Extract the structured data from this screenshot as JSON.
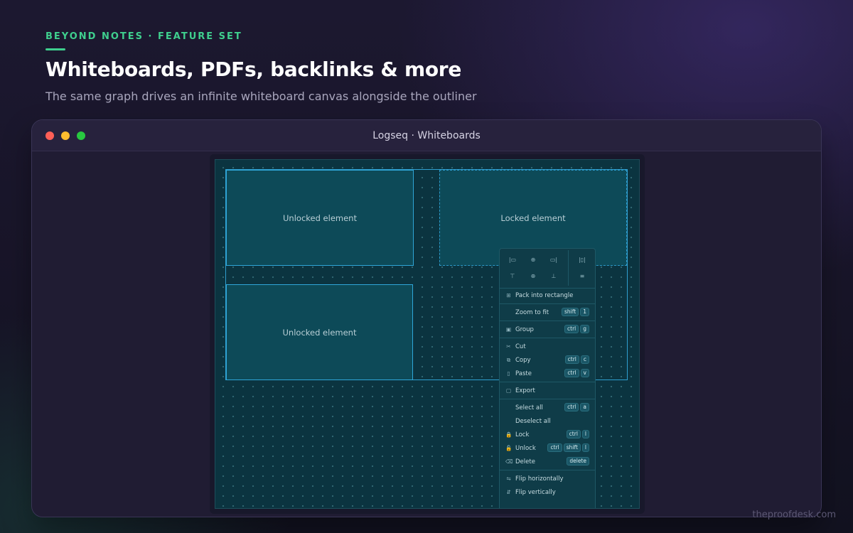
{
  "header": {
    "eyebrow": "BEYOND NOTES · FEATURE SET",
    "title": "Whiteboards, PDFs, backlinks & more",
    "subtitle": "The same graph drives an infinite whiteboard canvas alongside the outliner"
  },
  "window": {
    "title": "Logseq · Whiteboards"
  },
  "canvas": {
    "elements": [
      {
        "label": "Unlocked element",
        "locked": false
      },
      {
        "label": "Locked element",
        "locked": true
      },
      {
        "label": "Unlocked element",
        "locked": false
      }
    ]
  },
  "context_menu": {
    "align_icons": [
      "align-left-icon",
      "align-center-horizontal-icon",
      "align-right-icon",
      "distribute-horizontal-icon",
      "align-top-icon",
      "align-center-vertical-icon",
      "align-bottom-icon",
      "distribute-vertical-icon"
    ],
    "items": [
      {
        "label": "Pack into rectangle",
        "icon": "pack-icon",
        "shortcut": []
      },
      {
        "label": "Zoom to fit",
        "icon": "",
        "shortcut": [
          "shift",
          "1"
        ]
      },
      {
        "label": "Group",
        "icon": "group-icon",
        "shortcut": [
          "ctrl",
          "g"
        ]
      },
      {
        "label": "Cut",
        "icon": "scissors-icon",
        "shortcut": []
      },
      {
        "label": "Copy",
        "icon": "copy-icon",
        "shortcut": [
          "ctrl",
          "c"
        ]
      },
      {
        "label": "Paste",
        "icon": "clipboard-icon",
        "shortcut": [
          "ctrl",
          "v"
        ]
      },
      {
        "label": "Export",
        "icon": "file-icon",
        "shortcut": []
      },
      {
        "label": "Select all",
        "icon": "",
        "shortcut": [
          "ctrl",
          "a"
        ]
      },
      {
        "label": "Deselect all",
        "icon": "",
        "shortcut": []
      },
      {
        "label": "Lock",
        "icon": "lock-icon",
        "shortcut": [
          "ctrl",
          "l"
        ]
      },
      {
        "label": "Unlock",
        "icon": "unlock-icon",
        "shortcut": [
          "ctrl",
          "shift",
          "l"
        ]
      },
      {
        "label": "Delete",
        "icon": "eraser-icon",
        "shortcut": [
          "delete"
        ]
      },
      {
        "label": "Flip horizontally",
        "icon": "flip-horizontal-icon",
        "shortcut": []
      },
      {
        "label": "Flip vertically",
        "icon": "flip-vertical-icon",
        "shortcut": []
      }
    ]
  },
  "watermark": "theproofdesk.com",
  "colors": {
    "accent": "#3fcf8e",
    "selection": "#2fa6d8",
    "canvas_bg": "#0b3440",
    "element_fill": "#0d4a58"
  }
}
